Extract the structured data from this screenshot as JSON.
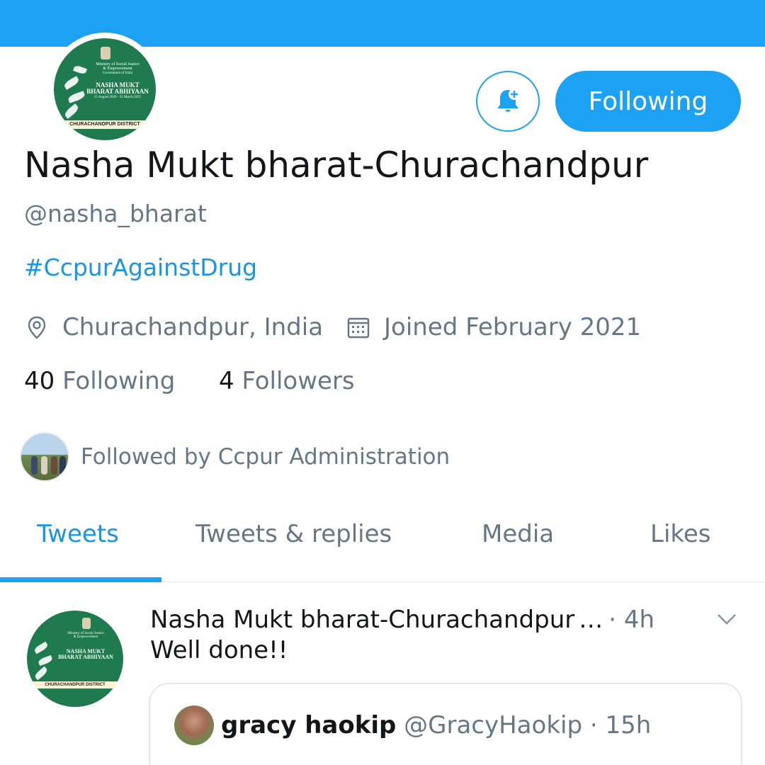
{
  "profile": {
    "name": "Nasha Mukt bharat-Churachandpur",
    "handle": "@nasha_bharat",
    "bio": "#CcpurAgainstDrug",
    "location": "Churachandpur, India",
    "joined": "Joined February 2021",
    "following_count": "40",
    "following_label": "Following",
    "followers_count": "4",
    "followers_label": "Followers",
    "followed_by": "Followed by Ccpur Administration",
    "follow_button": "Following",
    "logo": {
      "line1": "Ministry of Social Justice",
      "line2": "& Empowerment",
      "line3": "Government of India",
      "line4": "NASHA MUKT",
      "line5": "BHARAT ABHIYAAN",
      "line6": "15 August 2020 - 31 March 2021",
      "ribbon": "CHURACHANDPUR DISTRICT"
    }
  },
  "tabs": [
    {
      "label": "Tweets",
      "active": true
    },
    {
      "label": "Tweets & replies"
    },
    {
      "label": "Media"
    },
    {
      "label": "Likes"
    }
  ],
  "tweet": {
    "author": "Nasha Mukt bharat-Churachandpur",
    "ellipsis": "…",
    "time": "· 4h",
    "text": "Well done!!",
    "quoted": {
      "name": "gracy haokip",
      "handle": "@GracyHaokip",
      "time": "· 15h"
    }
  },
  "colors": {
    "accent": "#1da1f2",
    "link": "#1b95e0",
    "muted": "#657786",
    "logo_green": "#1f7a4f"
  },
  "icons": [
    "bell-plus-icon",
    "location-pin-icon",
    "calendar-icon",
    "chevron-down-icon"
  ]
}
